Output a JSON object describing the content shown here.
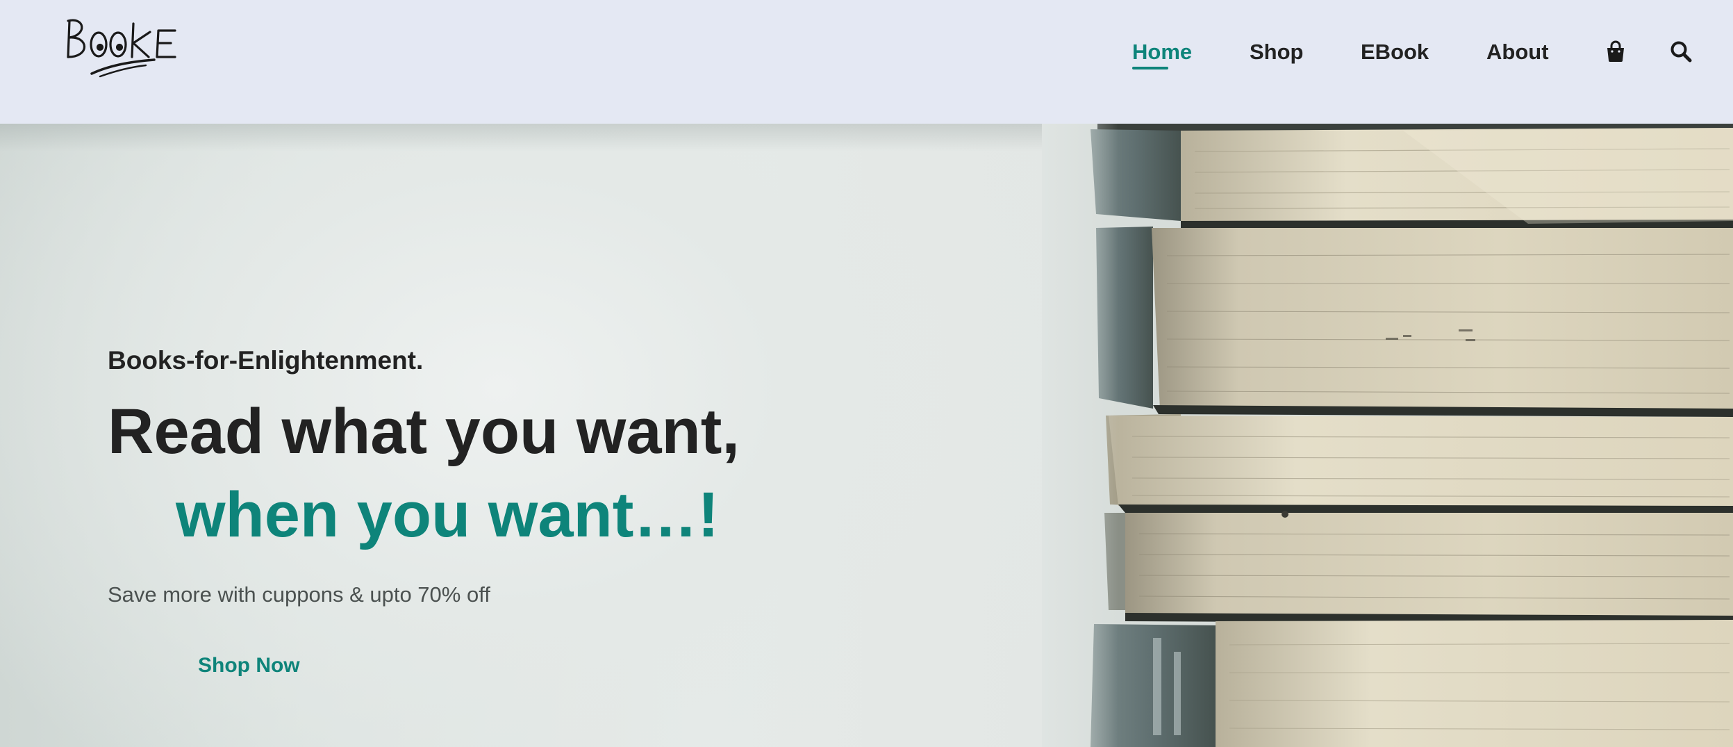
{
  "brand": {
    "logo_text": "BOOKE"
  },
  "nav": {
    "items": [
      {
        "label": "Home",
        "active": true
      },
      {
        "label": "Shop",
        "active": false
      },
      {
        "label": "EBook",
        "active": false
      },
      {
        "label": "About",
        "active": false
      }
    ],
    "icons": [
      "shopping-bag-icon",
      "search-icon"
    ]
  },
  "hero": {
    "tagline": "Books-for-Enlightenment.",
    "headline_line1": "Read what you want,",
    "headline_line2": "when you want…!",
    "subtext": "Save more with cuppons & upto 70% off",
    "cta_label": "Shop Now"
  },
  "colors": {
    "accent": "#0e847a",
    "text_dark": "#222222",
    "header_bg": "#e4e8f3"
  }
}
